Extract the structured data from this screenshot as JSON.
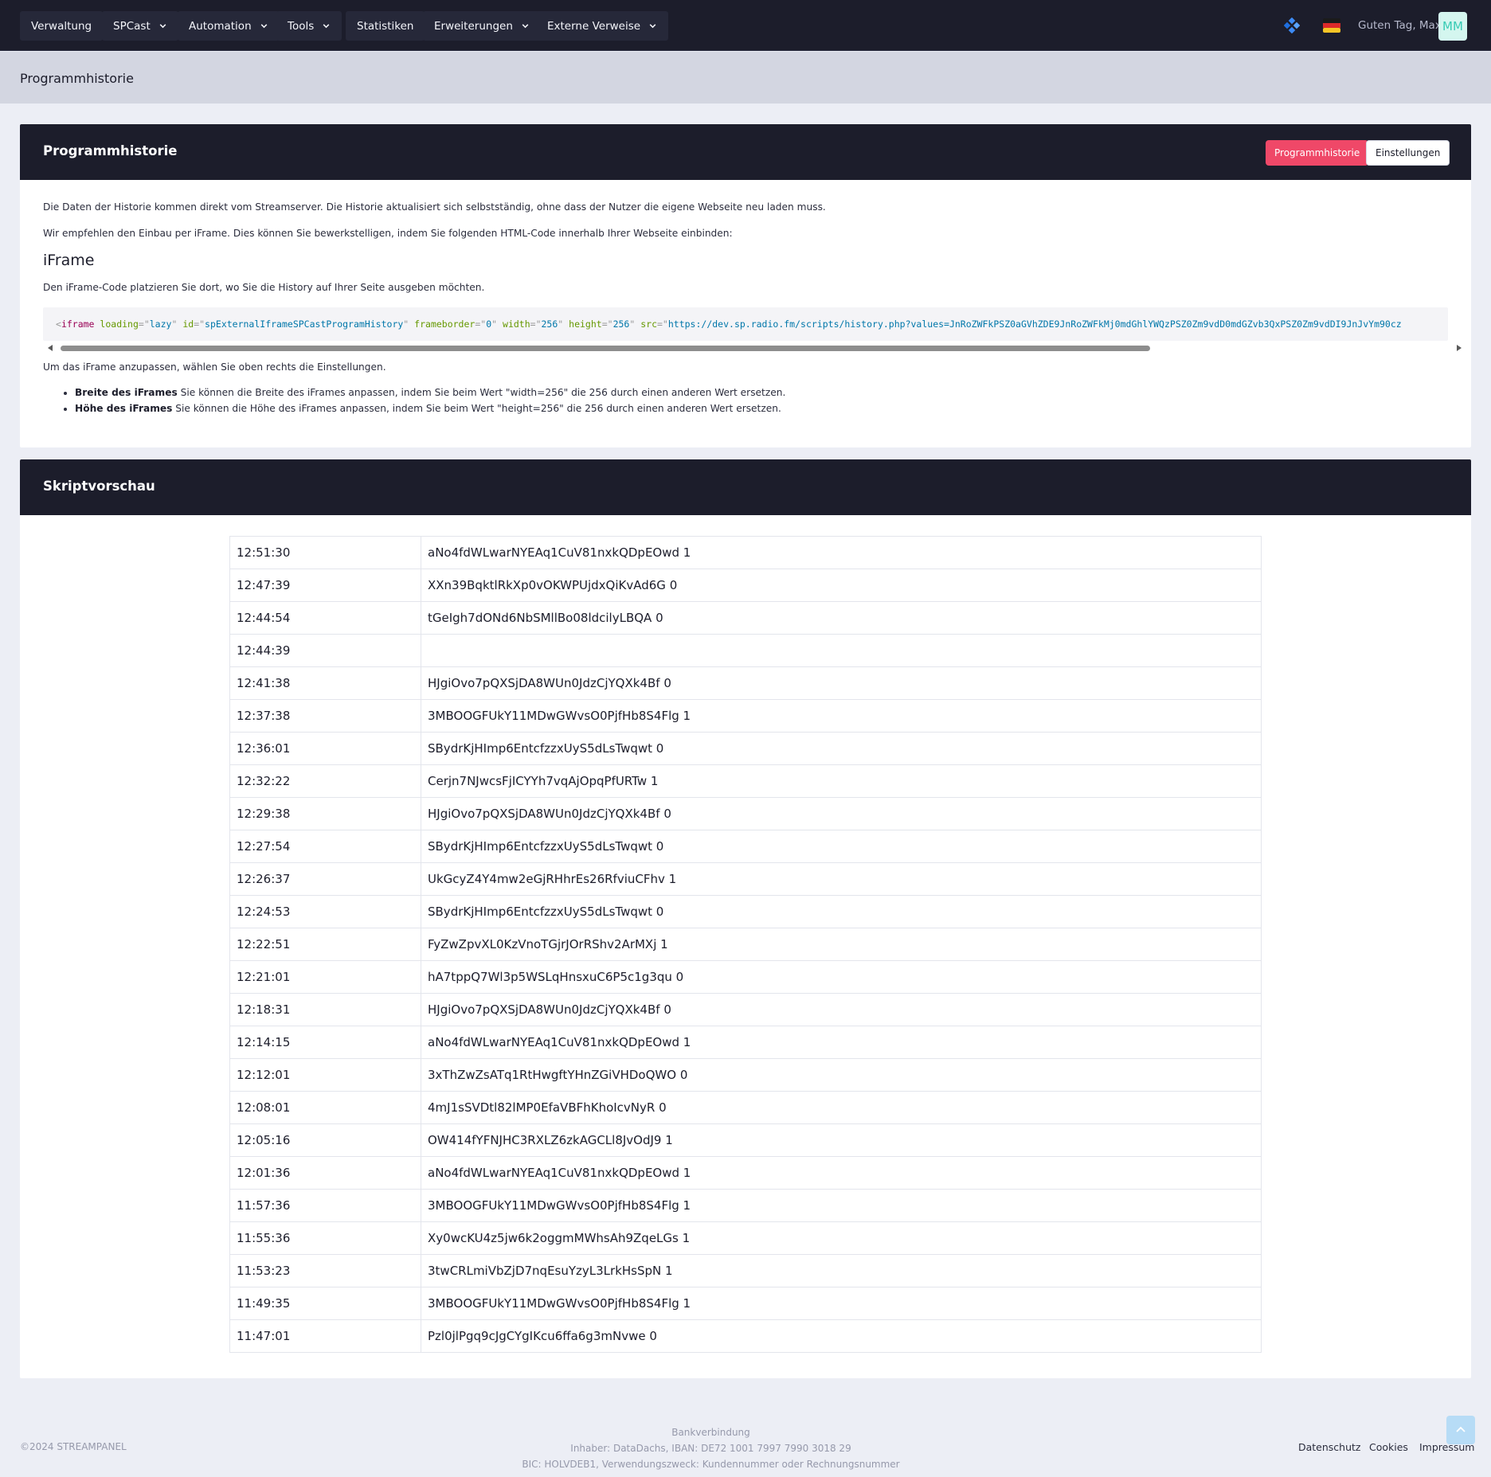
{
  "nav": {
    "items": [
      {
        "label": "Verwaltung",
        "dropdown": false
      },
      {
        "label": "SPCast",
        "dropdown": true
      },
      {
        "label": "Automation",
        "dropdown": true
      },
      {
        "label": "Tools",
        "dropdown": true
      },
      {
        "label": "Statistiken",
        "dropdown": false
      },
      {
        "label": "Erweiterungen",
        "dropdown": true
      },
      {
        "label": "Externe Verweise",
        "dropdown": true
      }
    ],
    "greeting": "Guten Tag, Max",
    "avatar_initials": "MM",
    "icons": [
      "widget-icon",
      "german-flag-icon"
    ]
  },
  "subheader": {
    "title": "Programmhistorie"
  },
  "info_card": {
    "title": "Programmhistorie",
    "btn_primary": "Programmhistorie",
    "btn_secondary": "Einstellungen",
    "p1": "Die Daten der Historie kommen direkt vom Streamserver. Die Historie aktualisiert sich selbstständig, ohne dass der Nutzer die eigene Webseite neu laden muss.",
    "p2": "Wir empfehlen den Einbau per iFrame. Dies können Sie bewerkstelligen, indem Sie folgenden HTML-Code innerhalb Ihrer Webseite einbinden:",
    "heading": "iFrame",
    "p3": "Den iFrame-Code platzieren Sie dort, wo Sie die History auf Ihrer Seite ausgeben möchten.",
    "code": {
      "tag": "iframe",
      "attrs": [
        {
          "name": "loading",
          "value": "lazy"
        },
        {
          "name": "id",
          "value": "spExternalIframeSPCastProgramHistory"
        },
        {
          "name": "frameborder",
          "value": "0"
        },
        {
          "name": "width",
          "value": "256"
        },
        {
          "name": "height",
          "value": "256"
        },
        {
          "name": "src",
          "value": "https://dev.sp.radio.fm/scripts/history.php?values=JnRoZWFkPSZ0aGVhZDE9JnRoZWFkMj0mdGhlYWQzPSZ0Zm9vdD0mdGZvb3QxPSZ0Zm9vdDI9JnJvYm90cz"
        }
      ]
    },
    "p4": "Um das iFrame anzupassen, wählen Sie oben rechts die Einstellungen.",
    "bullets": [
      {
        "bold": "Breite des iFrames",
        "text": " Sie können die Breite des iFrames anpassen, indem Sie beim Wert \"width=256\" die 256 durch einen anderen Wert ersetzen."
      },
      {
        "bold": "Höhe des iFrames",
        "text": " Sie können die Höhe des iFrames anpassen, indem Sie beim Wert \"height=256\" die 256 durch einen anderen Wert ersetzen."
      }
    ]
  },
  "preview_card": {
    "title": "Skriptvorschau",
    "rows": [
      {
        "time": "12:51:30",
        "title": "aNo4fdWLwarNYEAq1CuV81nxkQDpEOwd 1"
      },
      {
        "time": "12:47:39",
        "title": "XXn39BqktlRkXp0vOKWPUjdxQiKvAd6G 0"
      },
      {
        "time": "12:44:54",
        "title": "tGeIgh7dONd6NbSMllBo08ldcilyLBQA 0"
      },
      {
        "time": "12:44:39",
        "title": ""
      },
      {
        "time": "12:41:38",
        "title": "HJgiOvo7pQXSjDA8WUn0JdzCjYQXk4Bf 0"
      },
      {
        "time": "12:37:38",
        "title": "3MBOOGFUkY11MDwGWvsO0PjfHb8S4Flg 1"
      },
      {
        "time": "12:36:01",
        "title": "SBydrKjHImp6EntcfzzxUyS5dLsTwqwt 0"
      },
      {
        "time": "12:32:22",
        "title": "Cerjn7NJwcsFjICYYh7vqAjOpqPfURTw 1"
      },
      {
        "time": "12:29:38",
        "title": "HJgiOvo7pQXSjDA8WUn0JdzCjYQXk4Bf 0"
      },
      {
        "time": "12:27:54",
        "title": "SBydrKjHImp6EntcfzzxUyS5dLsTwqwt 0"
      },
      {
        "time": "12:26:37",
        "title": "UkGcyZ4Y4mw2eGjRHhrEs26RfviuCFhv 1"
      },
      {
        "time": "12:24:53",
        "title": "SBydrKjHImp6EntcfzzxUyS5dLsTwqwt 0"
      },
      {
        "time": "12:22:51",
        "title": "FyZwZpvXL0KzVnoTGjrJOrRShv2ArMXj 1"
      },
      {
        "time": "12:21:01",
        "title": "hA7tppQ7Wl3p5WSLqHnsxuC6P5c1g3qu 0"
      },
      {
        "time": "12:18:31",
        "title": "HJgiOvo7pQXSjDA8WUn0JdzCjYQXk4Bf 0"
      },
      {
        "time": "12:14:15",
        "title": "aNo4fdWLwarNYEAq1CuV81nxkQDpEOwd 1"
      },
      {
        "time": "12:12:01",
        "title": "3xThZwZsATq1RtHwgftYHnZGiVHDoQWO 0"
      },
      {
        "time": "12:08:01",
        "title": "4mJ1sSVDtl82lMP0EfaVBFhKhoIcvNyR 0"
      },
      {
        "time": "12:05:16",
        "title": "OW414fYFNJHC3RXLZ6zkAGCLl8JvOdJ9 1"
      },
      {
        "time": "12:01:36",
        "title": "aNo4fdWLwarNYEAq1CuV81nxkQDpEOwd 1"
      },
      {
        "time": "11:57:36",
        "title": "3MBOOGFUkY11MDwGWvsO0PjfHb8S4Flg 1"
      },
      {
        "time": "11:55:36",
        "title": "Xy0wcKU4z5jw6k2oggmMWhsAh9ZqeLGs 1"
      },
      {
        "time": "11:53:23",
        "title": "3twCRLmiVbZjD7nqEsuYzyL3LrkHsSpN 1"
      },
      {
        "time": "11:49:35",
        "title": "3MBOOGFUkY11MDwGWvsO0PjfHb8S4Flg 1"
      },
      {
        "time": "11:47:01",
        "title": "Pzl0jlPgq9cJgCYgIKcu6ffa6g3mNvwe 0"
      }
    ]
  },
  "footer": {
    "copyright": "©2024 STREAMPANEL",
    "bank_title": "Bankverbindung",
    "bank_line1": "Inhaber: DataDachs, IBAN: DE72 1001 7997 7990 3018 29",
    "bank_line2": "BIC: HOLVDEB1, Verwendungszweck: Kundennummer oder Rechnungsnummer",
    "links": [
      "Datenschutz",
      "Cookies",
      "Impressum"
    ]
  },
  "colors": {
    "nav_bg": "#1c1d2b",
    "accent": "#ef4868",
    "avatar_bg": "#d4f6ef",
    "avatar_fg": "#37cbb4"
  }
}
